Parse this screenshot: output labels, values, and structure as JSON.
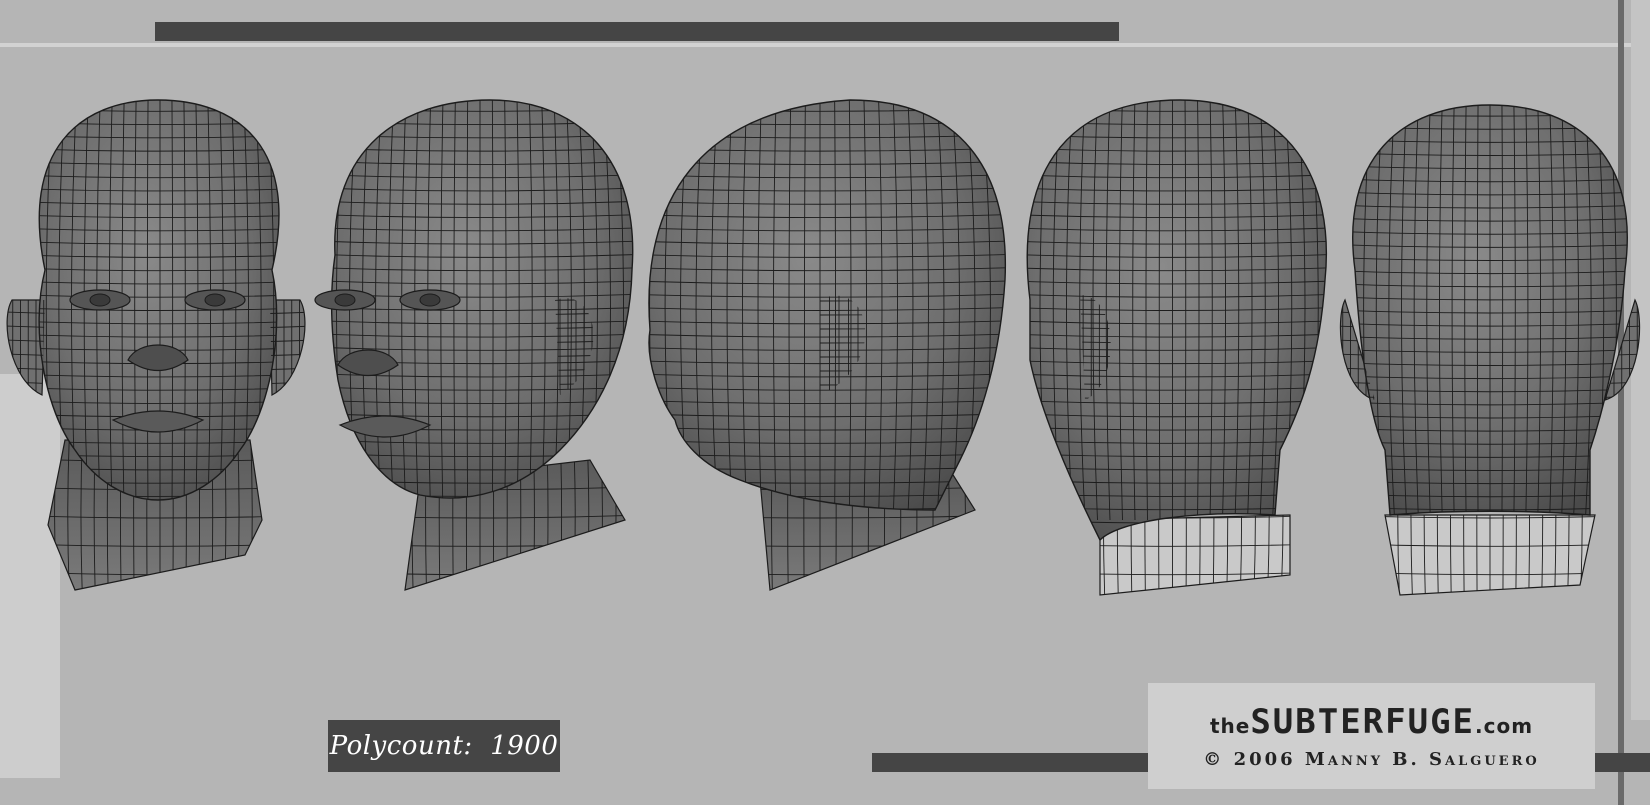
{
  "polycount": {
    "label": "Polycount:",
    "value": "1900"
  },
  "credit": {
    "brand_prefix": "the",
    "brand_main": "SUBTERFUGE",
    "brand_suffix": ".com",
    "copyright": "© 2006 Manny B. Salguero"
  },
  "views": [
    {
      "id": "front",
      "name": "front-view"
    },
    {
      "id": "three-quarter",
      "name": "three-quarter-view"
    },
    {
      "id": "profile",
      "name": "side-profile-view"
    },
    {
      "id": "rear-three-quarter",
      "name": "rear-three-quarter-view"
    },
    {
      "id": "back",
      "name": "back-view"
    }
  ],
  "colors": {
    "background": "#b5b5b5",
    "mesh_fill": "#6e6e6e",
    "wire": "#1c1c1c",
    "bar_dark": "#454545",
    "panel_light": "#cfcfcf"
  }
}
